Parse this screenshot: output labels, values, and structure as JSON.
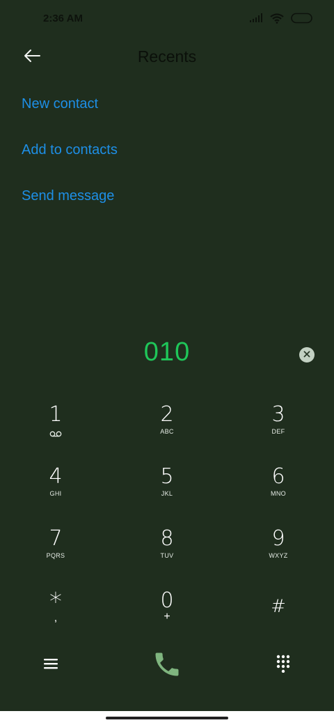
{
  "status_bar": {
    "time": "2:36 AM",
    "icons": [
      "signal-icon",
      "wifi-icon",
      "battery-icon"
    ]
  },
  "header": {
    "title": "Recents",
    "back_icon": "arrow-left-icon"
  },
  "actions": [
    {
      "label": "New contact"
    },
    {
      "label": "Add to contacts"
    },
    {
      "label": "Send message"
    }
  ],
  "dialer": {
    "number": "010",
    "clear_icon": "clear-icon"
  },
  "keypad": [
    {
      "digit": "1",
      "letters": "",
      "sub_icon": "voicemail-icon"
    },
    {
      "digit": "2",
      "letters": "ABC"
    },
    {
      "digit": "3",
      "letters": "DEF"
    },
    {
      "digit": "4",
      "letters": "GHI"
    },
    {
      "digit": "5",
      "letters": "JKL"
    },
    {
      "digit": "6",
      "letters": "MNO"
    },
    {
      "digit": "7",
      "letters": "PQRS"
    },
    {
      "digit": "8",
      "letters": "TUV"
    },
    {
      "digit": "9",
      "letters": "WXYZ"
    },
    {
      "digit": "*",
      "letters": ","
    },
    {
      "digit": "0",
      "letters": "+"
    },
    {
      "digit": "#",
      "letters": ""
    }
  ],
  "bottom_bar": {
    "menu_icon": "menu-icon",
    "call_icon": "phone-icon",
    "dialpad_icon": "dialpad-icon"
  },
  "colors": {
    "background": "#1f2e1e",
    "link": "#1e8fe6",
    "dialed_number": "#1fc659",
    "call_icon": "#7fb57f",
    "clear_button": "#c3d1c3"
  }
}
